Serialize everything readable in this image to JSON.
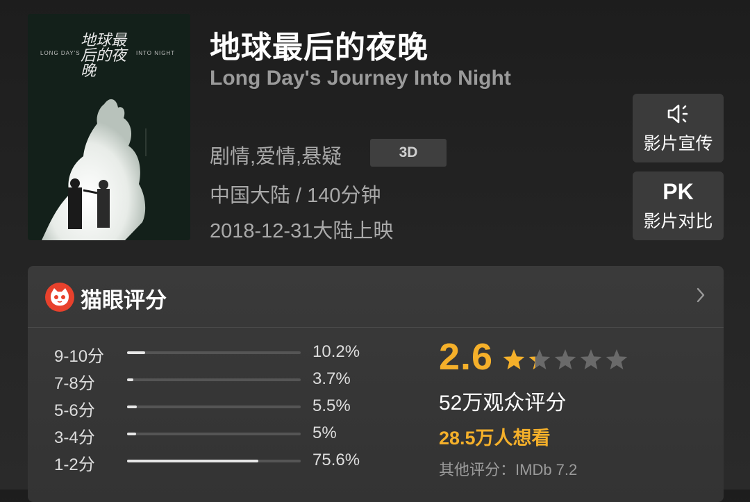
{
  "movie": {
    "title_cn": "地球最后的夜晚",
    "title_en": "Long Day's Journey Into Night",
    "genres": "剧情,爱情,悬疑",
    "format_badge": "3D",
    "region_duration": "中国大陆 / 140分钟",
    "release": "2018-12-31大陆上映"
  },
  "poster": {
    "title_art": "地球最后的夜晚",
    "en_left": "LONG DAY'S",
    "en_right": "INTO NIGHT"
  },
  "actions": {
    "promo_label": "影片宣传",
    "compare_icon_text": "PK",
    "compare_label": "影片对比"
  },
  "rating": {
    "brand": "猫眼评分",
    "distribution": [
      {
        "range": "9-10分",
        "percent": "10.2%",
        "fraction": 0.102
      },
      {
        "range": "7-8分",
        "percent": "3.7%",
        "fraction": 0.037
      },
      {
        "range": "5-6分",
        "percent": "5.5%",
        "fraction": 0.055
      },
      {
        "range": "3-4分",
        "percent": "5%",
        "fraction": 0.05
      },
      {
        "range": "1-2分",
        "percent": "75.6%",
        "fraction": 0.756
      }
    ],
    "score": "2.6",
    "stars_value": 1.3,
    "stars_max": 5,
    "viewers": "52万观众评分",
    "wants": "28.5万人想看",
    "other": "其他评分：IMDb 7.2"
  },
  "colors": {
    "accent_gold": "#f5b02a",
    "brand_red": "#e8412c",
    "star_empty": "#6a6a6a"
  },
  "icons": {
    "promo": "speaker-icon",
    "brand": "cat-logo-icon",
    "more": "chevron-right-icon"
  }
}
